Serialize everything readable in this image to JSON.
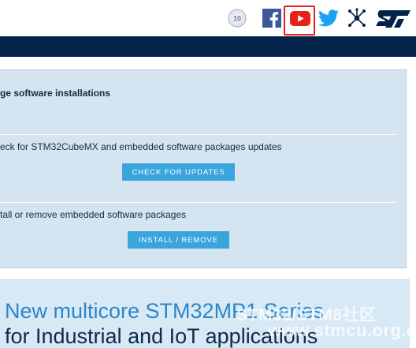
{
  "header": {
    "icons": [
      {
        "name": "award-badge-icon",
        "glyph": "10"
      },
      {
        "name": "facebook-icon",
        "glyph": "f"
      },
      {
        "name": "youtube-icon"
      },
      {
        "name": "twitter-icon"
      },
      {
        "name": "network-icon"
      },
      {
        "name": "st-logo-icon",
        "glyph": "ST"
      }
    ],
    "colors": {
      "facebook": "#3b5998",
      "youtube": "#e62117",
      "twitter": "#1da1f2",
      "navy": "#03234b",
      "highlight": "#e02020"
    }
  },
  "panel": {
    "title": "ge software installations",
    "check_text": "eck for STM32CubeMX and embedded software packages updates",
    "check_button": "CHECK FOR UPDATES",
    "install_text": "tall or remove embedded software packages",
    "install_button": "INSTALL / REMOVE",
    "colors": {
      "background": "#d5e4f1",
      "button": "#3aa4dc"
    }
  },
  "banner": {
    "line1": "New multicore STM32MP1 Series",
    "line2": "for Industrial and IoT applications",
    "watermark_line1": "STM32/STM8社区",
    "watermark_line2": "www.stmcu.org.cn"
  }
}
